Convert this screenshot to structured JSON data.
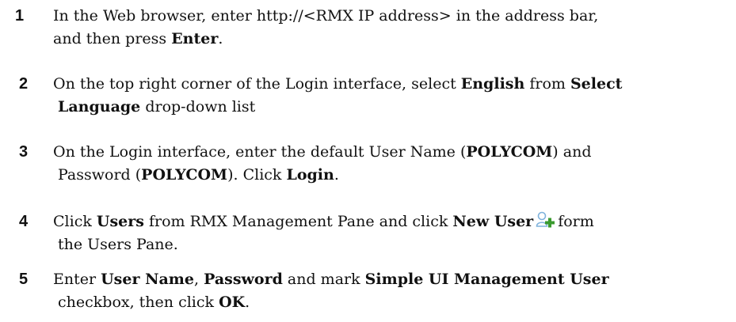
{
  "steps": [
    {
      "number": "1",
      "line1": [
        {
          "t": "In the Web browser, enter http://<RMX IP address> in the address bar,",
          "b": false
        }
      ],
      "line2": [
        {
          "t": "and then press ",
          "b": false
        },
        {
          "t": "Enter",
          "b": true
        },
        {
          "t": ".",
          "b": false
        }
      ]
    },
    {
      "number": "2",
      "line1": [
        {
          "t": "On the top right corner of the Login interface, select ",
          "b": false
        },
        {
          "t": "English",
          "b": true
        },
        {
          "t": " from ",
          "b": false
        },
        {
          "t": "Select",
          "b": true
        }
      ],
      "line2": [
        {
          "t": "Language",
          "b": true
        },
        {
          "t": " drop-down list",
          "b": false
        }
      ]
    },
    {
      "number": "3",
      "line1": [
        {
          "t": "On the Login interface, enter the default User Name (",
          "b": false
        },
        {
          "t": "POLYCOM",
          "b": true
        },
        {
          "t": ") and",
          "b": false
        }
      ],
      "line2": [
        {
          "t": "Password (",
          "b": false
        },
        {
          "t": "POLYCOM",
          "b": true
        },
        {
          "t": "). Click ",
          "b": false
        },
        {
          "t": "Login",
          "b": true
        },
        {
          "t": ".",
          "b": false
        }
      ]
    },
    {
      "number": "4",
      "line1": [
        {
          "t": "Click ",
          "b": false
        },
        {
          "t": "Users",
          "b": true
        },
        {
          "t": " from RMX Management Pane and click ",
          "b": false
        },
        {
          "t": "New User",
          "b": true
        },
        {
          "icon": "new-user-icon"
        },
        {
          "t": "form",
          "b": false
        }
      ],
      "line2": [
        {
          "t": "the Users Pane.",
          "b": false
        }
      ]
    },
    {
      "number": "5",
      "line1": [
        {
          "t": "Enter ",
          "b": false
        },
        {
          "t": "User Name",
          "b": true
        },
        {
          "t": ", ",
          "b": false
        },
        {
          "t": "Password",
          "b": true
        },
        {
          "t": " and mark ",
          "b": false
        },
        {
          "t": "Simple UI Management User",
          "b": true
        }
      ],
      "line2": [
        {
          "t": "checkbox, then click ",
          "b": false
        },
        {
          "t": "OK",
          "b": true
        },
        {
          "t": ".",
          "b": false
        }
      ]
    }
  ],
  "icons": {
    "new_user": "new-user-icon",
    "new_user_colors": {
      "person": "#7fb2dc",
      "plus": "#3a9a2e"
    }
  }
}
